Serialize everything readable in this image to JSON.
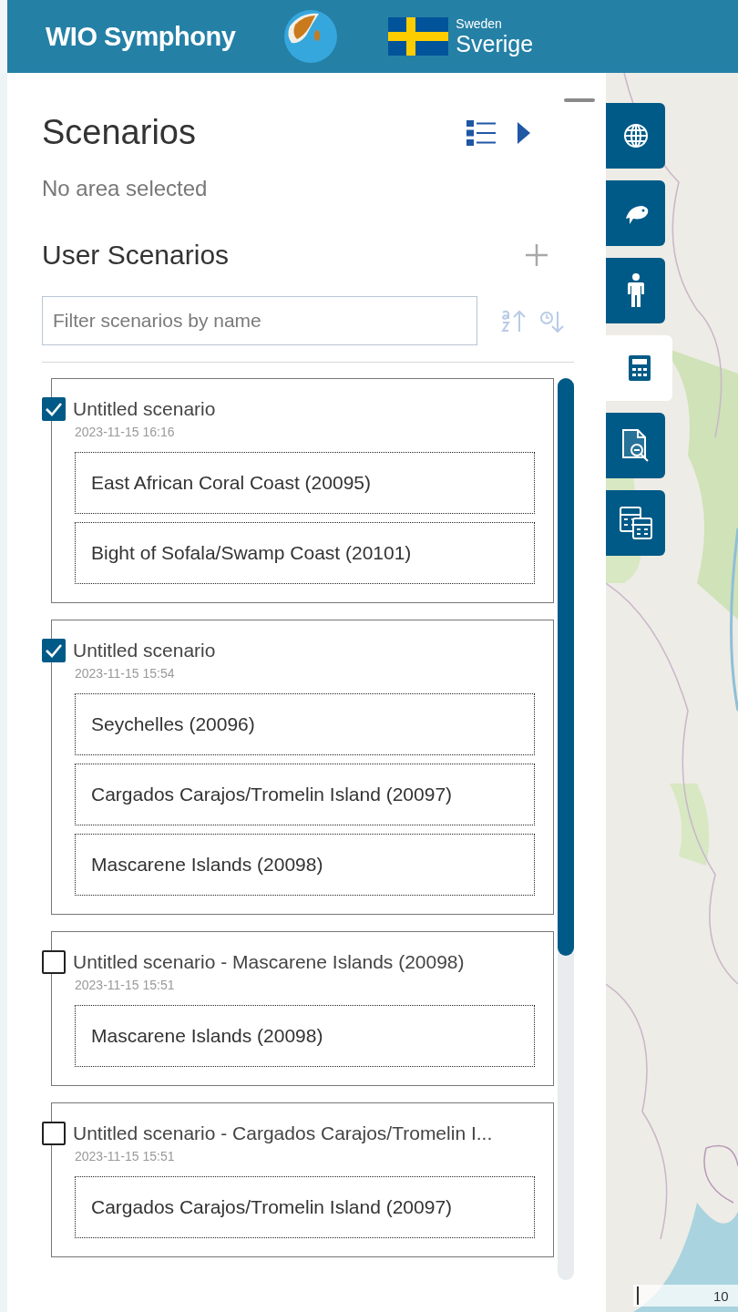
{
  "header": {
    "title": "WIO Symphony",
    "country_en": "Sweden",
    "country_native": "Sverige"
  },
  "panel": {
    "title": "Scenarios",
    "area_status": "No area selected",
    "section_title": "User Scenarios",
    "filter": {
      "placeholder": "Filter scenarios by name"
    }
  },
  "scenarios": [
    {
      "name": "Untitled scenario",
      "date": "2023-11-15 16:16",
      "checked": true,
      "areas": [
        "East African Coral Coast (20095)",
        "Bight of Sofala/Swamp Coast (20101)"
      ]
    },
    {
      "name": "Untitled scenario",
      "date": "2023-11-15 15:54",
      "checked": true,
      "areas": [
        "Seychelles (20096)",
        "Cargados Carajos/Tromelin Island (20097)",
        "Mascarene Islands (20098)"
      ]
    },
    {
      "name": "Untitled scenario - Mascarene Islands (20098)",
      "date": "2023-11-15 15:51",
      "checked": false,
      "areas": [
        "Mascarene Islands (20098)"
      ]
    },
    {
      "name": "Untitled scenario - Cargados Carajos/Tromelin I...",
      "date": "2023-11-15 15:51",
      "checked": false,
      "areas": [
        "Cargados Carajos/Tromelin Island (20097)"
      ]
    }
  ],
  "tools": [
    {
      "kind": "globe",
      "selected": false
    },
    {
      "kind": "fish",
      "selected": false
    },
    {
      "kind": "person",
      "selected": false
    },
    {
      "kind": "calculator",
      "selected": true
    },
    {
      "kind": "report",
      "selected": false
    },
    {
      "kind": "calculators",
      "selected": false
    }
  ],
  "map": {
    "scale_label": "10"
  }
}
